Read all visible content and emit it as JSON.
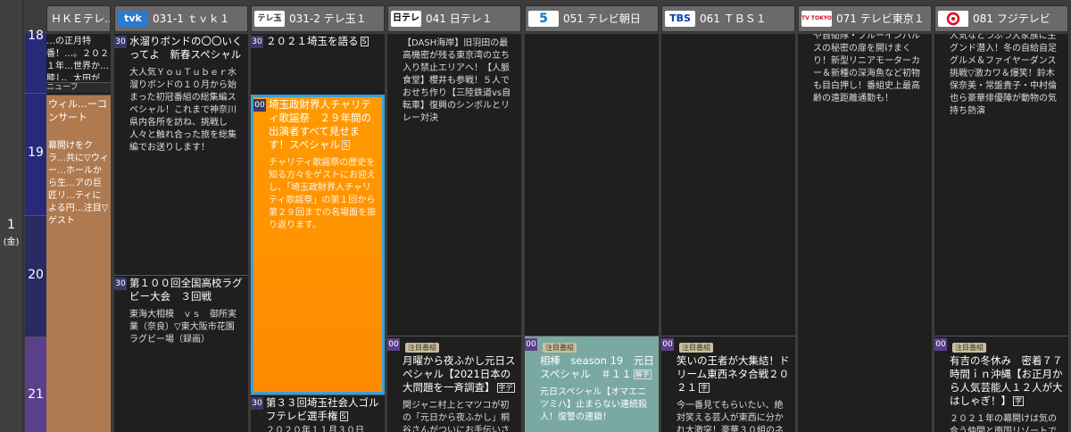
{
  "day": {
    "date": "1",
    "weekday": "(金)"
  },
  "hours": [
    "18",
    "19",
    "20",
    "21"
  ],
  "channels": [
    {
      "logo": "",
      "label": "ＨＫＥテレ…"
    },
    {
      "logo": "tvk",
      "label": "031-1 ｔｖｋ１"
    },
    {
      "logo": "テレ玉",
      "label": "031-2 テレ玉１"
    },
    {
      "logo": "日テレ",
      "label": "041 日テレ１"
    },
    {
      "logo": "5",
      "label": "051 テレビ朝日"
    },
    {
      "logo": "TBS",
      "label": "061 ＴＢＳ１"
    },
    {
      "logo": "TV TOKYO",
      "label": "071 テレビ東京１"
    },
    {
      "logo": "8",
      "label": "081 フジテレビ"
    }
  ],
  "etv": {
    "top_text": "…の正月特番！…。２０２１年…世界か…膝し、太田が",
    "mid": "ニューフ",
    "title": "ウィル…ーコンサート",
    "desc": "幕開けをクラ…共に▽ウィー…ホールから生…アの巨匠リ…ティによる円…注目▽ゲスト"
  },
  "tvk": [
    {
      "min": "30",
      "title": "水溜りボンドの〇〇いくってよ　新春スペシャル",
      "desc": "大人気ＹｏｕＴｕｂｅｒ水溜りボンドの１０月から始まった初冠番組の総集編スペシャル！これまで神奈川県内各所を訪ね、挑戦し人々と触れ合った旅を総集編でお送りします！"
    },
    {
      "min": "30",
      "title": "第１００回全国高校ラグビー大会　３回戦",
      "desc": "東海大相模　ｖｓ　御所実業（奈良）▽東大阪市花園ラグビー場（録画）"
    }
  ],
  "teletama": [
    {
      "min": "30",
      "title": "２０２１埼玉を語る",
      "mark": "S"
    },
    {
      "min": "00",
      "title": "埼玉政財界人チャリティ歌謡祭　２９年間の出演者すべて見せます！スペシャル",
      "mark": "S",
      "desc": "チャリティ歌謡祭の歴史を知る方々をゲストにお迎えし、「埼玉政財界人チャリティ歌謡祭」の第１回から第２９回までの名場面を振り返ります。"
    },
    {
      "min": "30",
      "title": "第３３回埼玉社会人ゴルフテレビ選手権",
      "mark": "S",
      "desc": "２０２０年１１月３０日"
    }
  ],
  "ntv": [
    {
      "desc": "【DASH海岸】旧羽田の最高機密が残る東京湾の立ち入り禁止エリアへ！【人脈食堂】櫻井も参戦！５人でおせち作り【三陸鉄道vs自転車】復興のシンボルとリレー対決"
    },
    {
      "min": "00",
      "tag": "注目番組",
      "title": "月曜から夜ふかし元日スペシャル【2021日本の大問題を一斉調査】",
      "mark": "字デ",
      "desc": "関ジャニ村上とマツコが初の「元日から夜ふかし」桐谷さんがついにお手伝いさ"
    }
  ],
  "tvasahi": [
    {
      "min": "00",
      "tag": "注目番組",
      "title": "相棒　season 19　元日スペシャル　＃１１",
      "mark": "解字",
      "desc": "元日スペシャル【オマエニツミハ】止まらない連続殺人！復讐の連鎖！"
    }
  ],
  "tbs": [
    {
      "min": "00",
      "tag": "注目番組",
      "title": "笑いの王者が大集結！ドリーム東西ネタ合戦２０２１",
      "mark": "字",
      "desc": "今一番見てもらいたい、絶対笑える芸人が東西に分かれ大激突！豪華３０組のネタ"
    }
  ],
  "tvtokyo": [
    {
      "desc": "や自衛隊・ブルーインパルスの秘密の扉を開けまくり！新型リニアモーターカー＆新種の深海魚など初物も目白押し！番組史上最高齢の遠距離通勤も！"
    }
  ],
  "fuji": [
    {
      "desc": "人気なとつぶつ大家族に生グンド潜入！冬の自給自足グルメ＆ファイヤーダンス挑戦▽激カワ＆爆笑！鈴木保奈美・常盤貴子・中村倫也ら豪華俳優陣が動物の気持ち熱演"
    },
    {
      "min": "00",
      "tag": "注目番組",
      "title": "有吉の冬休み　密着７７時間ｉｎ沖縄【お正月から人気芸能人１２人が大はしゃぎ！】",
      "mark": "字",
      "desc": "２０２１年の幕開けは気の合う仲間と南国リゾートで"
    }
  ],
  "colors": {
    "highlight": "#ff9a00",
    "highlight_border": "#3aa0d8",
    "tvasahi_bg": "#7aa8a3",
    "etv_bg": "#b07a50"
  }
}
